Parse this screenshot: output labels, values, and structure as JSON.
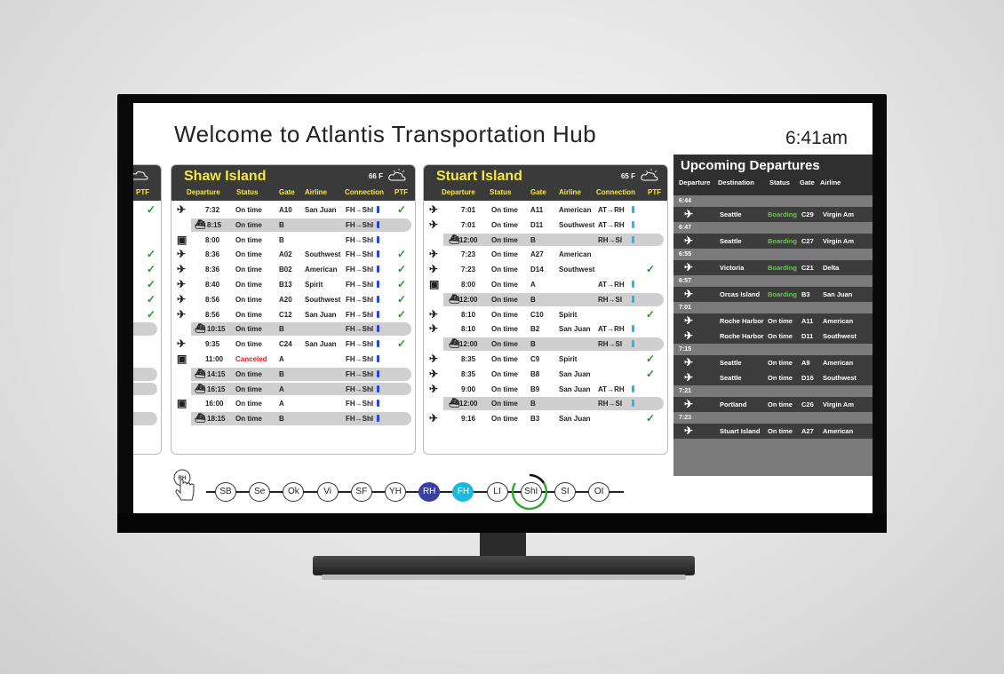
{
  "welcome": "Welcome to Atlantis Transportation Hub",
  "clock": "6:41am",
  "partial_card": {
    "col_fragment": "n",
    "col_ptf": "PTF"
  },
  "columns": {
    "departure": "Departure",
    "status": "Status",
    "gate": "Gate",
    "airline": "Airline",
    "connection": "Connection",
    "ptf": "PTF"
  },
  "shaw": {
    "title": "Shaw Island",
    "temp": "66 F",
    "rows": [
      {
        "icon": "plane",
        "time": "7:32",
        "status": "On time",
        "gate": "A10",
        "airline": "San Juan",
        "conn": "FH→ShI",
        "check": "✓"
      },
      {
        "icon": "ferry",
        "time": "8:15",
        "status": "On time",
        "gate": "B",
        "airline": "",
        "conn": "FH→ShI",
        "check": ""
      },
      {
        "icon": "train",
        "time": "8:00",
        "status": "On time",
        "gate": "B",
        "airline": "",
        "conn": "FH→ShI",
        "check": ""
      },
      {
        "icon": "plane",
        "time": "8:36",
        "status": "On time",
        "gate": "A02",
        "airline": "Southwest",
        "conn": "FH→ShI",
        "check": "✓"
      },
      {
        "icon": "plane",
        "time": "8:36",
        "status": "On time",
        "gate": "B02",
        "airline": "American",
        "conn": "FH→ShI",
        "check": "✓"
      },
      {
        "icon": "plane",
        "time": "8:40",
        "status": "On time",
        "gate": "B13",
        "airline": "Spirit",
        "conn": "FH→ShI",
        "check": "✓"
      },
      {
        "icon": "plane",
        "time": "8:56",
        "status": "On time",
        "gate": "A20",
        "airline": "Southwest",
        "conn": "FH→ShI",
        "check": "✓"
      },
      {
        "icon": "plane",
        "time": "8:56",
        "status": "On time",
        "gate": "C12",
        "airline": "San Juan",
        "conn": "FH→ShI",
        "check": "✓"
      },
      {
        "icon": "ferry",
        "time": "10:15",
        "status": "On time",
        "gate": "B",
        "airline": "",
        "conn": "FH→ShI",
        "check": ""
      },
      {
        "icon": "plane",
        "time": "9:35",
        "status": "On time",
        "gate": "C24",
        "airline": "San Juan",
        "conn": "FH→ShI",
        "check": "✓"
      },
      {
        "icon": "train",
        "time": "11:00",
        "status": "Canceled",
        "gate": "A",
        "airline": "",
        "conn": "FH→ShI",
        "check": ""
      },
      {
        "icon": "ferry",
        "time": "14:15",
        "status": "On time",
        "gate": "B",
        "airline": "",
        "conn": "FH→ShI",
        "check": ""
      },
      {
        "icon": "ferry",
        "time": "16:15",
        "status": "On time",
        "gate": "A",
        "airline": "",
        "conn": "FH→ShI",
        "check": ""
      },
      {
        "icon": "train",
        "time": "16:00",
        "status": "On time",
        "gate": "A",
        "airline": "",
        "conn": "FH→ShI",
        "check": ""
      },
      {
        "icon": "ferry",
        "time": "18:15",
        "status": "On time",
        "gate": "B",
        "airline": "",
        "conn": "FH→ShI",
        "check": ""
      }
    ]
  },
  "stuart": {
    "title": "Stuart Island",
    "temp": "65 F",
    "rows": [
      {
        "icon": "plane",
        "time": "7:01",
        "status": "On time",
        "gate": "A11",
        "airline": "American",
        "conn": "AT→RH",
        "check": ""
      },
      {
        "icon": "plane",
        "time": "7:01",
        "status": "On time",
        "gate": "D11",
        "airline": "Southwest",
        "conn": "AT→RH",
        "check": ""
      },
      {
        "icon": "ferry",
        "time": "12:00",
        "status": "On time",
        "gate": "B",
        "airline": "",
        "conn": "RH→SI",
        "check": ""
      },
      {
        "icon": "plane",
        "time": "7:23",
        "status": "On time",
        "gate": "A27",
        "airline": "American",
        "conn": "",
        "check": ""
      },
      {
        "icon": "plane",
        "time": "7:23",
        "status": "On time",
        "gate": "D14",
        "airline": "Southwest",
        "conn": "",
        "check": "✓"
      },
      {
        "icon": "train",
        "time": "8:00",
        "status": "On time",
        "gate": "A",
        "airline": "",
        "conn": "AT→RH",
        "check": ""
      },
      {
        "icon": "ferry",
        "time": "12:00",
        "status": "On time",
        "gate": "B",
        "airline": "",
        "conn": "RH→SI",
        "check": ""
      },
      {
        "icon": "plane",
        "time": "8:10",
        "status": "On time",
        "gate": "C10",
        "airline": "Spirit",
        "conn": "",
        "check": "✓"
      },
      {
        "icon": "plane",
        "time": "8:10",
        "status": "On time",
        "gate": "B2",
        "airline": "San Juan",
        "conn": "AT→RH",
        "check": ""
      },
      {
        "icon": "ferry",
        "time": "12:00",
        "status": "On time",
        "gate": "B",
        "airline": "",
        "conn": "RH→SI",
        "check": ""
      },
      {
        "icon": "plane",
        "time": "8:35",
        "status": "On time",
        "gate": "C9",
        "airline": "Spirit",
        "conn": "",
        "check": "✓"
      },
      {
        "icon": "plane",
        "time": "8:35",
        "status": "On time",
        "gate": "B8",
        "airline": "San Juan",
        "conn": "",
        "check": "✓"
      },
      {
        "icon": "plane",
        "time": "9:00",
        "status": "On time",
        "gate": "B9",
        "airline": "San Juan",
        "conn": "AT→RH",
        "check": ""
      },
      {
        "icon": "ferry",
        "time": "12:00",
        "status": "On time",
        "gate": "B",
        "airline": "",
        "conn": "RH→SI",
        "check": ""
      },
      {
        "icon": "plane",
        "time": "9:16",
        "status": "On time",
        "gate": "B3",
        "airline": "San Juan",
        "conn": "",
        "check": "✓"
      }
    ]
  },
  "upcoming": {
    "title": "Upcoming Departures",
    "columns": {
      "departure": "Departure",
      "destination": "Destination",
      "status": "Status",
      "gate": "Gate",
      "airline": "Airline"
    },
    "groups": [
      {
        "time": "6:44",
        "rows": [
          {
            "dest": "Seattle",
            "status": "Boarding",
            "gate": "C29",
            "airline": "Virgin Am"
          }
        ]
      },
      {
        "time": "6:47",
        "rows": [
          {
            "dest": "Seattle",
            "status": "Boarding",
            "gate": "C27",
            "airline": "Virgin Am"
          }
        ]
      },
      {
        "time": "6:55",
        "rows": [
          {
            "dest": "Victoria",
            "status": "Boarding",
            "gate": "C21",
            "airline": "Delta"
          }
        ]
      },
      {
        "time": "6:57",
        "rows": [
          {
            "dest": "Orcas Island",
            "status": "Boarding",
            "gate": "B3",
            "airline": "San Juan"
          }
        ]
      },
      {
        "time": "7:01",
        "rows": [
          {
            "dest": "Roche Harbor",
            "status": "On time",
            "gate": "A11",
            "airline": "American"
          },
          {
            "dest": "Roche Harbor",
            "status": "On time",
            "gate": "D11",
            "airline": "Southwest"
          }
        ]
      },
      {
        "time": "7:15",
        "rows": [
          {
            "dest": "Seattle",
            "status": "On time",
            "gate": "A9",
            "airline": "American"
          },
          {
            "dest": "Seattle",
            "status": "On time",
            "gate": "D16",
            "airline": "Southwest"
          }
        ]
      },
      {
        "time": "7:21",
        "rows": [
          {
            "dest": "Portland",
            "status": "On time",
            "gate": "C26",
            "airline": "Virgin Am"
          }
        ]
      },
      {
        "time": "7:23",
        "rows": [
          {
            "dest": "Stuart Island",
            "status": "On time",
            "gate": "A27",
            "airline": "American"
          }
        ]
      }
    ]
  },
  "route": {
    "hand_label": "RH",
    "stops": [
      "SB",
      "Se",
      "Ok",
      "Vi",
      "SF",
      "YH",
      "RH",
      "FH",
      "LI",
      "ShI",
      "SI",
      "OI"
    ]
  },
  "colors": {
    "header_yellow": "#f2e84a",
    "canceled_red": "#d62020",
    "check_green": "#1e9a1e",
    "boarding_green": "#6fc15a",
    "stop_rh": "#3b3fa0",
    "stop_fh": "#1cb8e0"
  }
}
